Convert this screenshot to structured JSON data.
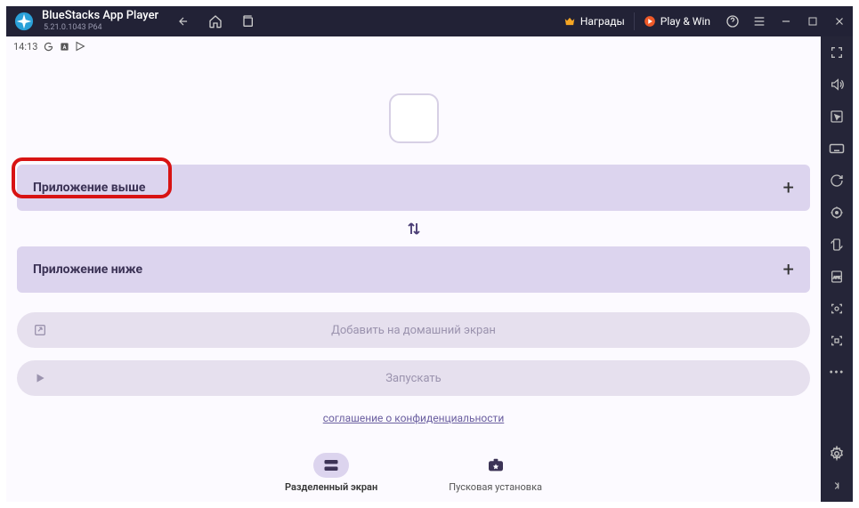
{
  "titlebar": {
    "title": "BlueStacks App Player",
    "version": "5.21.0.1043  P64",
    "rewards": "Награды",
    "playwin": "Play & Win"
  },
  "statusbar": {
    "time": "14:13"
  },
  "rows": {
    "top": "Приложение выше",
    "bottom": "Приложение ниже"
  },
  "buttons": {
    "addhome": "Добавить на домашний экран",
    "launch": "Запускать"
  },
  "privacy": "соглашение о конфиденциальности",
  "bottomnav": {
    "split": "Разделенный экран",
    "launcher": "Пусковая установка"
  }
}
